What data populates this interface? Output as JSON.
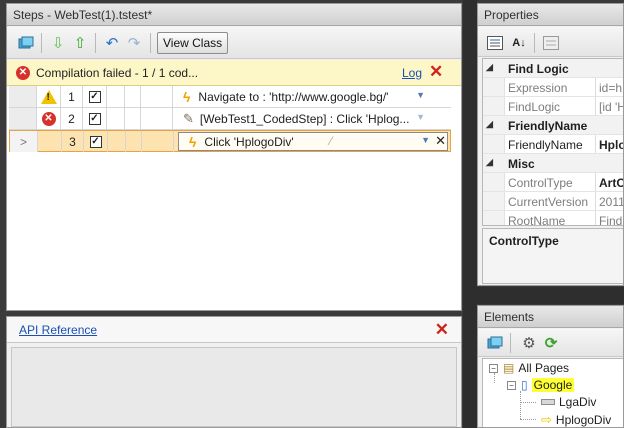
{
  "steps_panel": {
    "title": "Steps - WebTest(1).tstest*",
    "toolbar": {
      "icons": [
        "record-icon",
        "move-down-icon",
        "move-up-icon",
        "undo-icon",
        "redo-icon"
      ],
      "view_class_label": "View Class"
    },
    "error_bar": {
      "message": "Compilation failed - 1 / 1 cod...",
      "log_link": "Log",
      "close": "✕"
    },
    "rows": [
      {
        "status": "warning",
        "number": "1",
        "checked": true,
        "icon": "lightning-icon",
        "description": "Navigate to : 'http://www.google.bg/'",
        "selected": false
      },
      {
        "status": "error",
        "number": "2",
        "checked": true,
        "icon": "coded-step-icon",
        "description": "[WebTest1_CodedStep] : Click 'Hplog...",
        "selected": false
      },
      {
        "status": "current",
        "number": "3",
        "checked": true,
        "icon": "lightning-icon",
        "description": "Click 'HplogoDiv'",
        "selected": true
      }
    ],
    "row_pointer": ">",
    "row_delete": "✕"
  },
  "api_panel": {
    "link": "API Reference",
    "close": "✕"
  },
  "properties_panel": {
    "title": "Properties",
    "categories": [
      {
        "name": "Find Logic",
        "items": [
          {
            "name": "Expression",
            "value": "id=h"
          },
          {
            "name": "FindLogic",
            "value": "[id 'H"
          }
        ]
      },
      {
        "name": "FriendlyName",
        "items": [
          {
            "name": "FriendlyName",
            "value": "Hplo",
            "bold": true
          }
        ]
      },
      {
        "name": "Misc",
        "items": [
          {
            "name": "ControlType",
            "value": "ArtO"
          },
          {
            "name": "CurrentVersion",
            "value": "2011"
          },
          {
            "name": "RootName",
            "value": "Find"
          }
        ]
      }
    ],
    "description_title": "ControlType"
  },
  "elements_panel": {
    "title": "Elements",
    "tree": {
      "root": "All Pages",
      "page": "Google",
      "children": [
        "LgaDiv",
        "HplogoDiv"
      ]
    }
  },
  "colors": {
    "error_bar_bg": "#fdf7c8",
    "selected_row_bg": "#fde3b0",
    "link": "#1a4fb4",
    "close_red": "#d0231c",
    "highlight": "#ffff33"
  }
}
